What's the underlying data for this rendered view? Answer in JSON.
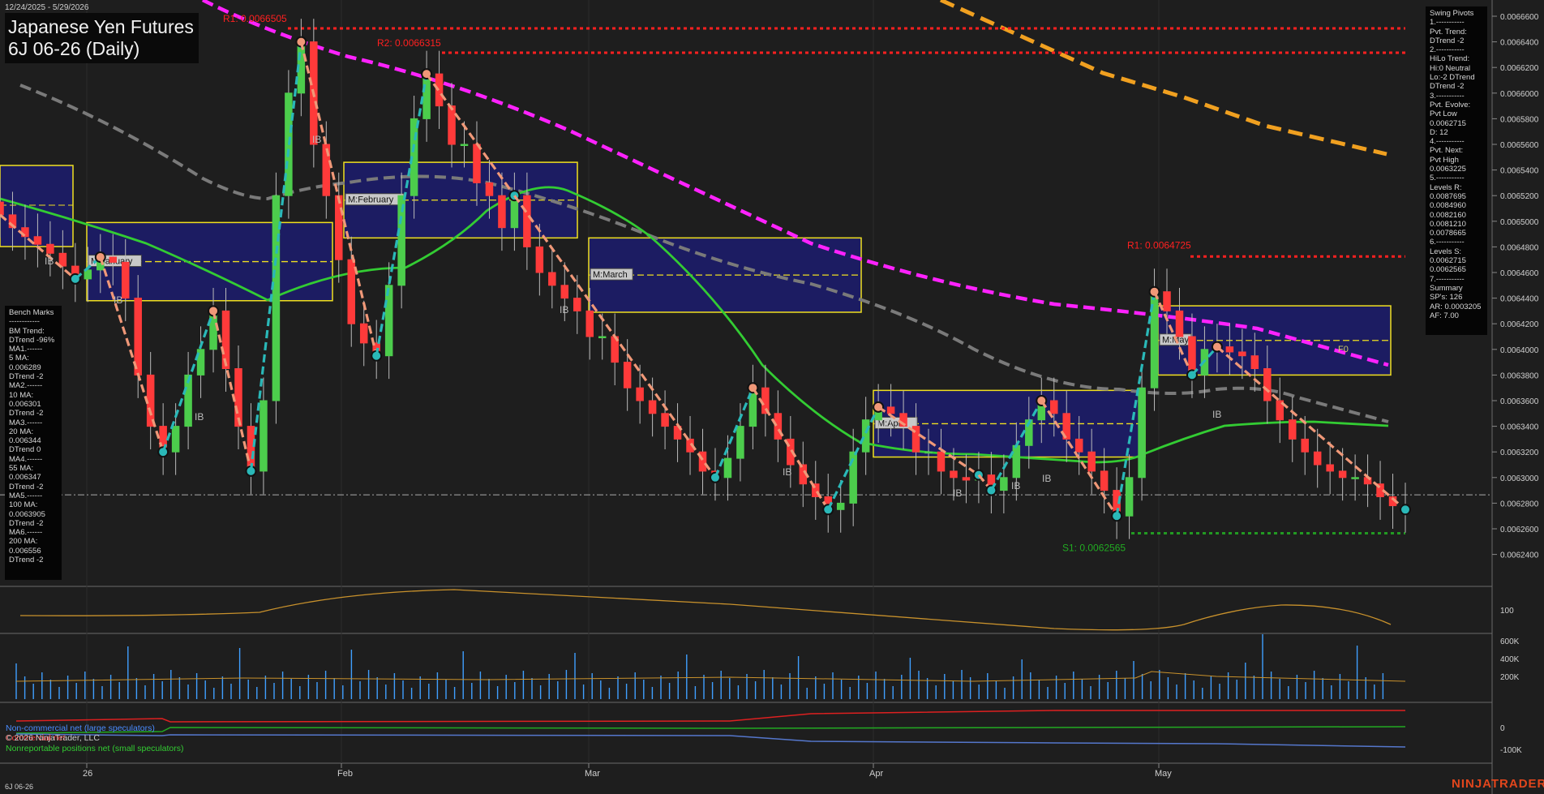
{
  "header": {
    "date_range": "12/24/2025 - 5/29/2026",
    "title_line1": "Japanese Yen Futures",
    "title_line2": "6J 06-26 (Daily)"
  },
  "footer": {
    "instrument": "6J 06-26",
    "logo": "NINJATRADER",
    "copyright": "© 2026 NinjaTrader, LLC"
  },
  "bench_marks": [
    "Bench Marks",
    "------------",
    "BM Trend:",
    "DTrend -96%",
    "MA1.------",
    "5 MA:",
    "0.006289",
    "DTrend -2",
    "MA2.------",
    "10 MA:",
    "0.006301",
    "DTrend -2",
    "MA3.------",
    "20 MA:",
    "0.006344",
    "DTrend 0",
    "MA4.------",
    "55 MA:",
    "0.006347",
    "DTrend -2",
    "MA5.------",
    "100 MA:",
    "0.0063905",
    "DTrend -2",
    "MA6.------",
    "200 MA:",
    "0.006556",
    "DTrend -2"
  ],
  "swing_pivots": [
    "Swing Pivots",
    "1.-----------",
    "Pvt. Trend:",
    "DTrend -2",
    "2.-----------",
    "HiLo Trend:",
    "Hi:0 Neutral",
    "Lo:-2 DTrend",
    "DTrend -2",
    "3.-----------",
    "Pvt. Evolve:",
    "Pvt Low",
    "0.0062715",
    "D: 12",
    "4.-----------",
    "Pvt. Next:",
    "Pvt High",
    "0.0063225",
    "5.-----------",
    "Levels R:",
    "0.0087695",
    "0.0084960",
    "0.0082160",
    "0.0081210",
    "0.0078665",
    "6.-----------",
    "Levels S:",
    "0.0062715",
    "0.0062565",
    "7.-----------",
    "Summary",
    "SP's: 126",
    "AR: 0.0003205",
    "AF: 7.00"
  ],
  "cot_legend": {
    "noncommercial": "Non-commercial net (large speculators)",
    "commercial": "Commercial net",
    "nonreportable": "Nonreportable positions net (small speculators)"
  },
  "colors": {
    "background": "#1e1e1e",
    "up_candle": "#4ccd4c",
    "down_candle": "#ff3a3a",
    "ma_magenta": "#ff22ff",
    "ma_orange": "#f0a020",
    "ma_gray": "#7a7a7a",
    "ma_green": "#33cc33",
    "pivot_red": "#ff2020",
    "support_green": "#229922",
    "swing_up": "#2ab8b8",
    "swing_down": "#f09878",
    "volume": "#3f9fff",
    "monthly_box_fill": "#1c1c6e",
    "monthly_box_border": "#f0e020"
  },
  "chart_data": {
    "type": "candlestick",
    "date_range": [
      "2025-12-24",
      "2026-05-29"
    ],
    "y_axis": {
      "ticks": [
        "0.0066600",
        "0.0066400",
        "0.0066200",
        "0.0066000",
        "0.0065800",
        "0.0065600",
        "0.0065400",
        "0.0065200",
        "0.0065000",
        "0.0064800",
        "0.0064600",
        "0.0064400",
        "0.0064200",
        "0.0064000",
        "0.0063800",
        "0.0063600",
        "0.0063400",
        "0.0063200",
        "0.0063000",
        "0.0062800",
        "0.0062600",
        "0.0062400"
      ],
      "range": [
        0.00622,
        0.006675
      ],
      "last_price": 0.0062865
    },
    "x_labels": [
      "26",
      "Feb",
      "Mar",
      "Apr",
      "May"
    ],
    "closes": [
      0.006505,
      0.006495,
      0.006488,
      0.006482,
      0.006475,
      0.006465,
      0.006455,
      0.006462,
      0.006472,
      0.006468,
      0.00644,
      0.00638,
      0.00634,
      0.00632,
      0.00634,
      0.00638,
      0.0064,
      0.00643,
      0.006385,
      0.00634,
      0.006305,
      0.00636,
      0.00652,
      0.0066,
      0.00664,
      0.00656,
      0.00652,
      0.00647,
      0.00642,
      0.006405,
      0.006395,
      0.00645,
      0.00652,
      0.00658,
      0.006615,
      0.00659,
      0.00656,
      0.00656,
      0.00653,
      0.00652,
      0.006495,
      0.00652,
      0.00648,
      0.00646,
      0.00645,
      0.00644,
      0.00643,
      0.00641,
      0.00641,
      0.00639,
      0.00637,
      0.00636,
      0.00635,
      0.00634,
      0.00633,
      0.00632,
      0.006305,
      0.0063,
      0.006315,
      0.00634,
      0.00637,
      0.00635,
      0.00633,
      0.00631,
      0.006295,
      0.006285,
      0.006275,
      0.00628,
      0.00632,
      0.006345,
      0.006355,
      0.00635,
      0.00634,
      0.00632,
      0.00632,
      0.006305,
      0.0063,
      0.006298,
      0.006302,
      0.00629,
      0.0063,
      0.006325,
      0.006345,
      0.00636,
      0.00635,
      0.00633,
      0.00632,
      0.006305,
      0.00629,
      0.00627,
      0.0063,
      0.00637,
      0.006445,
      0.00643,
      0.00641,
      0.00638,
      0.0064,
      0.006402,
      0.006398,
      0.006395,
      0.006385,
      0.00636,
      0.006345,
      0.00633,
      0.00632,
      0.00631,
      0.006305,
      0.0063,
      0.0063,
      0.006295,
      0.006285,
      0.006278,
      0.006275
    ],
    "moving_averages": [
      {
        "name": "5 MA",
        "value": 0.006289
      },
      {
        "name": "10 MA",
        "value": 0.006301
      },
      {
        "name": "20 MA",
        "value": 0.006344
      },
      {
        "name": "55 MA",
        "value": 0.006347
      },
      {
        "name": "100 MA",
        "value": 0.0063905
      },
      {
        "name": "200 MA",
        "value": 0.006556
      }
    ],
    "pivot_labels": [
      {
        "text": "R1: 0.0066505",
        "value": 0.0066505
      },
      {
        "text": "R2: 0.0066315",
        "value": 0.0066315
      },
      {
        "text": "R1: 0.0064725",
        "value": 0.0064725
      },
      {
        "text": "S1: 0.0062565",
        "value": 0.0062565
      }
    ],
    "monthly_boxes": [
      {
        "label": "M:January",
        "high": 0.006499,
        "low": 0.006438
      },
      {
        "label": "M:February",
        "high": 0.006546,
        "low": 0.006487
      },
      {
        "label": "M:March",
        "high": 0.006487,
        "low": 0.006429
      },
      {
        "label": "M:April",
        "high": 0.006368,
        "low": 0.006316
      },
      {
        "label": "M:May",
        "high": 0.006434,
        "low": 0.00638
      }
    ],
    "inside_bar_label": "IB",
    "f0_label": "F0",
    "oscillator_label": "100",
    "volume_axis": [
      "600K",
      "400K",
      "200K"
    ],
    "cot_axis": [
      "0",
      "-100K"
    ]
  }
}
